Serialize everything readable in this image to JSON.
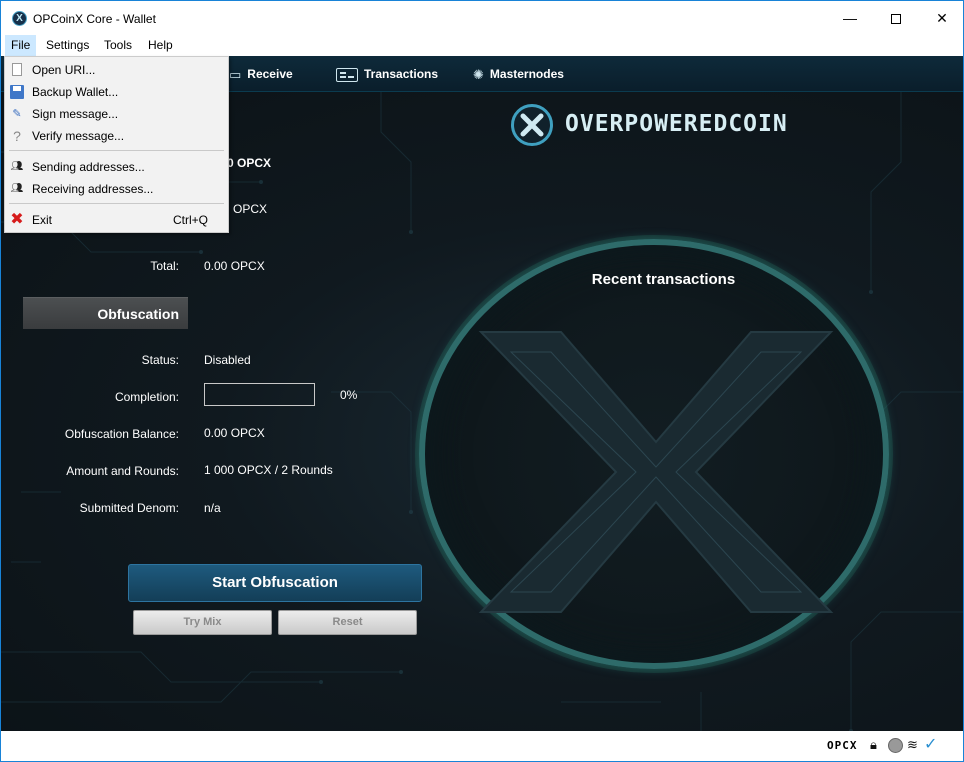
{
  "window": {
    "title": "OPCoinX Core - Wallet",
    "controls": {
      "minimize": "—",
      "close": "✕"
    }
  },
  "menubar": {
    "items": [
      "File",
      "Settings",
      "Tools",
      "Help"
    ]
  },
  "file_menu": {
    "items": [
      {
        "label": "Open URI...",
        "icon": "document-icon"
      },
      {
        "label": "Backup Wallet...",
        "icon": "save-icon"
      },
      {
        "label": "Sign message...",
        "icon": "pen-icon"
      },
      {
        "label": "Verify message...",
        "icon": "question-icon"
      },
      {
        "label": "Sending addresses...",
        "icon": "people-icon"
      },
      {
        "label": "Receiving addresses...",
        "icon": "people-icon"
      },
      {
        "label": "Exit",
        "icon": "exit-icon",
        "shortcut": "Ctrl+Q"
      }
    ]
  },
  "toolbar": {
    "receive": "Receive",
    "transactions": "Transactions",
    "masternodes": "Masternodes"
  },
  "logo": {
    "text": "OVERPOWEREDCOIN"
  },
  "balances": {
    "partial_1": "0 OPCX",
    "partial_2": "OPCX",
    "total_label": "Total:",
    "total_value": "0.00 OPCX"
  },
  "obfuscation": {
    "header": "Obfuscation",
    "status_label": "Status:",
    "status_value": "Disabled",
    "completion_label": "Completion:",
    "completion_value": "0%",
    "completion_fraction": 0,
    "balance_label": "Obfuscation Balance:",
    "balance_value": "0.00 OPCX",
    "rounds_label": "Amount and Rounds:",
    "rounds_value": "1 000 OPCX / 2 Rounds",
    "denom_label": "Submitted Denom:",
    "denom_value": "n/a",
    "start_button": "Start Obfuscation",
    "trymix_button": "Try Mix",
    "reset_button": "Reset"
  },
  "recent": {
    "title": "Recent transactions"
  },
  "statusbar": {
    "unit": "OPCX"
  },
  "colors": {
    "accent": "#1e5a7e",
    "background": "#10191f",
    "ring": "#2e6b6a"
  }
}
